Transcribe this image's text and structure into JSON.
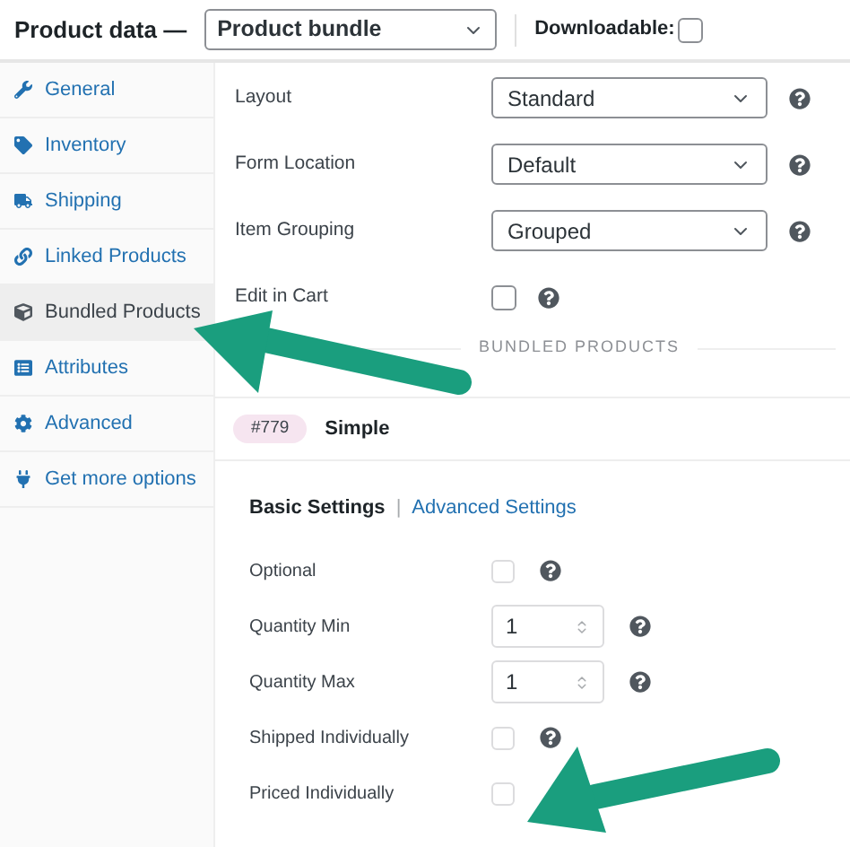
{
  "header": {
    "title": "Product data —",
    "product_type": "Product bundle",
    "downloadable": {
      "label": "Downloadable:",
      "checked": false
    }
  },
  "sidebar": {
    "items": [
      {
        "label": "General",
        "selected": false
      },
      {
        "label": "Inventory",
        "selected": false
      },
      {
        "label": "Shipping",
        "selected": false
      },
      {
        "label": "Linked Products",
        "selected": false
      },
      {
        "label": "Bundled Products",
        "selected": true
      },
      {
        "label": "Attributes",
        "selected": false
      },
      {
        "label": "Advanced",
        "selected": false
      },
      {
        "label": "Get more options",
        "selected": false
      }
    ]
  },
  "settings": {
    "rows": [
      {
        "label": "Layout",
        "kind": "select",
        "value": "Standard",
        "help": true
      },
      {
        "label": "Form Location",
        "kind": "select",
        "value": "Default",
        "help": true
      },
      {
        "label": "Item Grouping",
        "kind": "select",
        "value": "Grouped",
        "help": true
      },
      {
        "label": "Edit in Cart",
        "kind": "checkbox",
        "checked": false,
        "help": true
      }
    ]
  },
  "section_heading": "BUNDLED PRODUCTS",
  "bundled_item": {
    "id": "#779",
    "title": "Simple",
    "tabs": [
      {
        "label": "Basic Settings",
        "selected": true
      },
      {
        "label": "Advanced Settings",
        "selected": false
      }
    ],
    "tab_separator": "|",
    "rows": [
      {
        "label": "Optional",
        "kind": "checkbox",
        "checked": false,
        "help": true
      },
      {
        "label": "Quantity Min",
        "kind": "number",
        "value": "1",
        "help": true
      },
      {
        "label": "Quantity Max",
        "kind": "number",
        "value": "1",
        "help": true
      },
      {
        "label": "Shipped Individually",
        "kind": "checkbox",
        "checked": false,
        "help": true
      },
      {
        "label": "Priced Individually",
        "kind": "checkbox",
        "checked": false,
        "help": false
      }
    ]
  }
}
